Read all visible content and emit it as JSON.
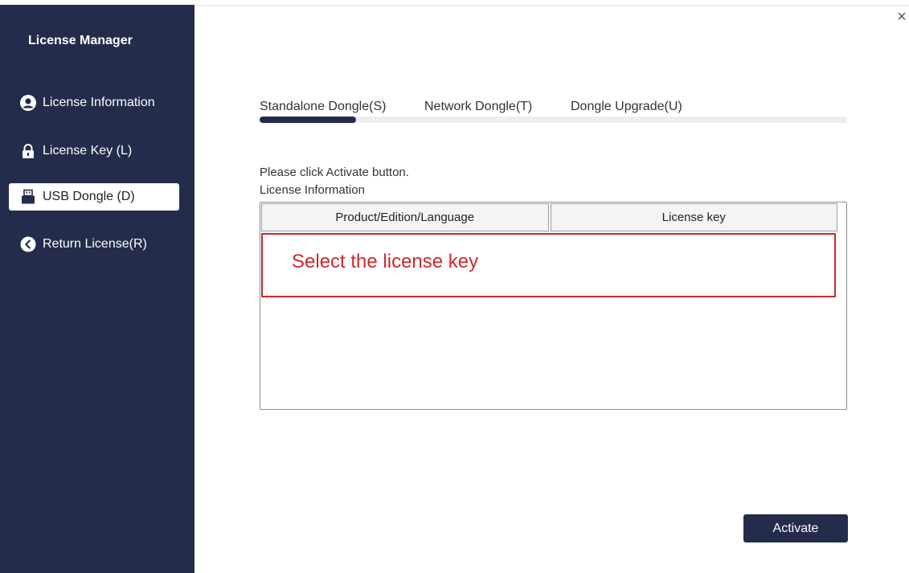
{
  "app": {
    "title": "License Manager"
  },
  "window": {
    "close_label": "×"
  },
  "sidebar": {
    "items": [
      {
        "label": "License Information",
        "icon": "user-icon",
        "active": false
      },
      {
        "label": "License Key (L)",
        "icon": "lock-icon",
        "active": false
      },
      {
        "label": "USB Dongle (D)",
        "icon": "usb-icon",
        "active": true
      },
      {
        "label": "Return License(R)",
        "icon": "chevron-left-icon",
        "active": false
      }
    ]
  },
  "tabs": [
    {
      "label": "Standalone Dongle(S)",
      "active": true
    },
    {
      "label": "Network Dongle(T)",
      "active": false
    },
    {
      "label": "Dongle Upgrade(U)",
      "active": false
    }
  ],
  "main": {
    "message": "Please click Activate button.",
    "section_label": "License Information",
    "table": {
      "columns": [
        "Product/Edition/Language",
        "License key"
      ],
      "rows": []
    },
    "hint": "Select the license key",
    "activate_label": "Activate"
  },
  "colors": {
    "sidebar_bg": "#232c4a",
    "accent": "#232c4a",
    "hint_red": "#d0282a"
  }
}
